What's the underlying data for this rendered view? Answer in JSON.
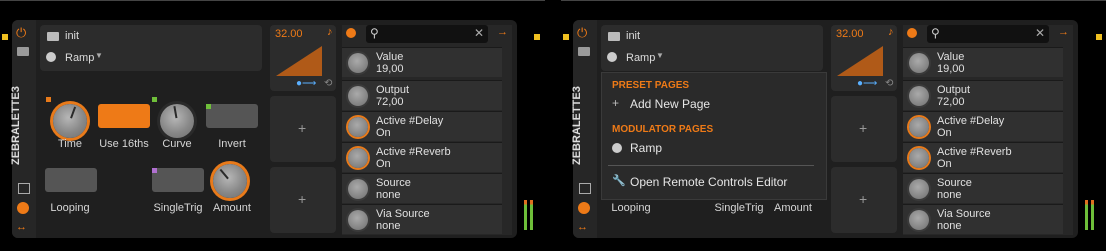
{
  "device": {
    "name": "ZEBRALETTE3",
    "preset": "init",
    "page": "Ramp",
    "controls": [
      {
        "label": "Time",
        "type": "knob"
      },
      {
        "label": "Use 16ths",
        "type": "toggle",
        "on": true
      },
      {
        "label": "Curve",
        "type": "knob"
      },
      {
        "label": "Invert",
        "type": "toggle",
        "on": false
      },
      {
        "label": "Looping",
        "type": "toggle",
        "on": false
      },
      {
        "label": "SingleTrig",
        "type": "toggle",
        "on": false
      },
      {
        "label": "Amount",
        "type": "knob"
      }
    ]
  },
  "modulator": {
    "rate": "32.00",
    "add_symbol": "+"
  },
  "remote_controls": [
    {
      "name": "Value",
      "value": "19,00"
    },
    {
      "name": "Output",
      "value": "72,00"
    },
    {
      "name": "Active #Delay",
      "value": "On"
    },
    {
      "name": "Active #Reverb",
      "value": "On"
    },
    {
      "name": "Source",
      "value": "none"
    },
    {
      "name": "Via Source",
      "value": "none"
    }
  ],
  "menu": {
    "preset_header": "PRESET PAGES",
    "add_new_page": "Add New Page",
    "modulator_header": "MODULATOR PAGES",
    "ramp_item": "Ramp",
    "open_editor": "Open Remote Controls Editor"
  },
  "icons": {
    "power": "power-icon",
    "folder": "folder-icon",
    "search": "search-icon",
    "clear": "close-icon",
    "arrow": "arrow-right-icon"
  },
  "colors": {
    "accent": "#ee7a17",
    "panel": "#1f1f1f",
    "meter_green": "#6fbf3a"
  }
}
